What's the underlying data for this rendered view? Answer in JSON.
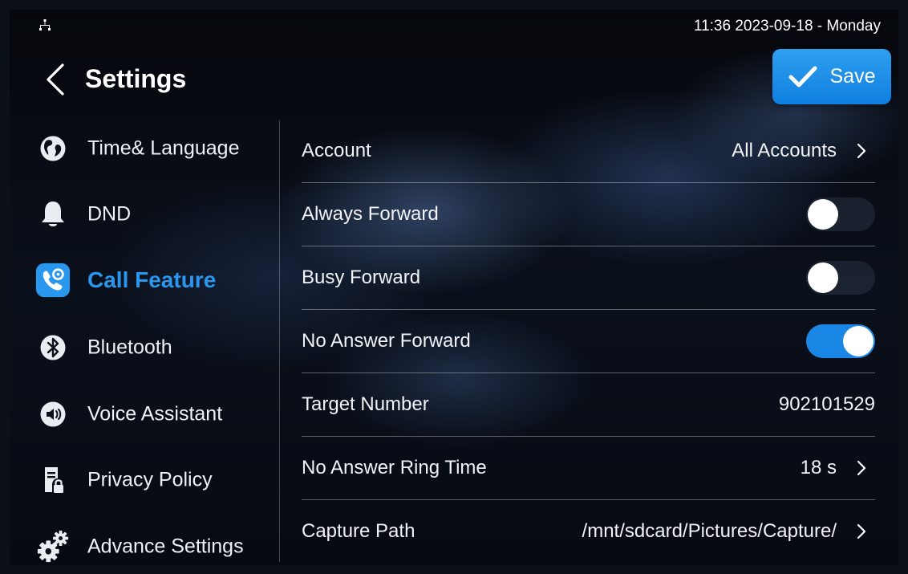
{
  "status_bar": {
    "datetime": "11:36  2023-09-18 - Monday",
    "network_icon": "network-icon"
  },
  "header": {
    "title": "Settings",
    "back_icon": "chevron-left-icon",
    "save_label": "Save",
    "save_icon": "checkmark-icon"
  },
  "sidebar": {
    "items": [
      {
        "label": "Time& Language",
        "icon": "globe-icon",
        "active": false
      },
      {
        "label": "DND",
        "icon": "bell-icon",
        "active": false
      },
      {
        "label": "Call Feature",
        "icon": "call-settings-icon",
        "active": true
      },
      {
        "label": "Bluetooth",
        "icon": "bluetooth-icon",
        "active": false
      },
      {
        "label": "Voice Assistant",
        "icon": "speaker-icon",
        "active": false
      },
      {
        "label": "Privacy Policy",
        "icon": "privacy-document-icon",
        "active": false
      },
      {
        "label": "Advance Settings",
        "icon": "gears-icon",
        "active": false
      }
    ]
  },
  "main": {
    "rows": [
      {
        "label": "Account",
        "value": "All Accounts",
        "type": "link"
      },
      {
        "label": "Always Forward",
        "type": "toggle",
        "on": false
      },
      {
        "label": "Busy Forward",
        "type": "toggle",
        "on": false
      },
      {
        "label": "No Answer Forward",
        "type": "toggle",
        "on": true
      },
      {
        "label": "Target Number",
        "value": "902101529",
        "type": "value"
      },
      {
        "label": "No Answer Ring Time",
        "value": "18 s",
        "type": "link"
      },
      {
        "label": "Capture Path",
        "value": "/mnt/sdcard/Pictures/Capture/",
        "type": "link"
      }
    ]
  },
  "colors": {
    "accent": "#1a86e6",
    "active_text": "#2a97ee",
    "toggle_off": "#1e2634"
  }
}
